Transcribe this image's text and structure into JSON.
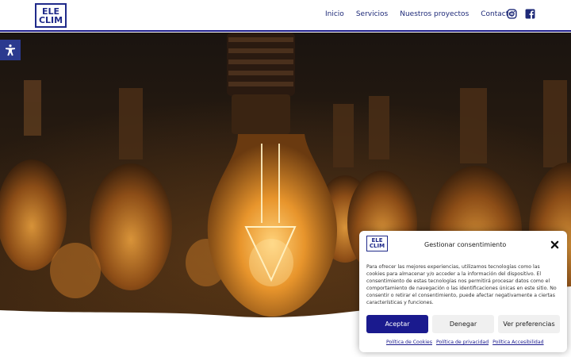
{
  "header": {
    "logo": {
      "line1": "ELE",
      "line2": "CLIM"
    },
    "nav": [
      {
        "label": "Inicio"
      },
      {
        "label": "Servicios"
      },
      {
        "label": "Nuestros proyectos"
      },
      {
        "label": "Contacto"
      }
    ],
    "social": [
      {
        "icon": "instagram-icon"
      },
      {
        "icon": "facebook-icon"
      }
    ]
  },
  "hero": {
    "image": "hanging-edison-light-bulbs"
  },
  "accessibility_button": {
    "icon": "accessibility-icon"
  },
  "consent": {
    "logo": {
      "line1": "ELE",
      "line2": "CLIM"
    },
    "title": "Gestionar consentimiento",
    "body": "Para ofrecer las mejores experiencias, utilizamos tecnologías como las cookies para almacenar y/o acceder a la información del dispositivo. El consentimiento de estas tecnologías nos permitirá procesar datos como el comportamiento de navegación o las identificaciones únicas en este sitio. No consentir o retirar el consentimiento, puede afectar negativamente a ciertas características y funciones.",
    "buttons": {
      "accept": "Aceptar",
      "deny": "Denegar",
      "preferences": "Ver preferencias"
    },
    "links": [
      "Política de Cookies",
      "Política de privacidad",
      "Política Accesibilidad"
    ]
  },
  "colors": {
    "brand_navy": "#1e2a78",
    "accept_button": "#1a1a8e",
    "accessibility_button": "#2b3a8f"
  }
}
